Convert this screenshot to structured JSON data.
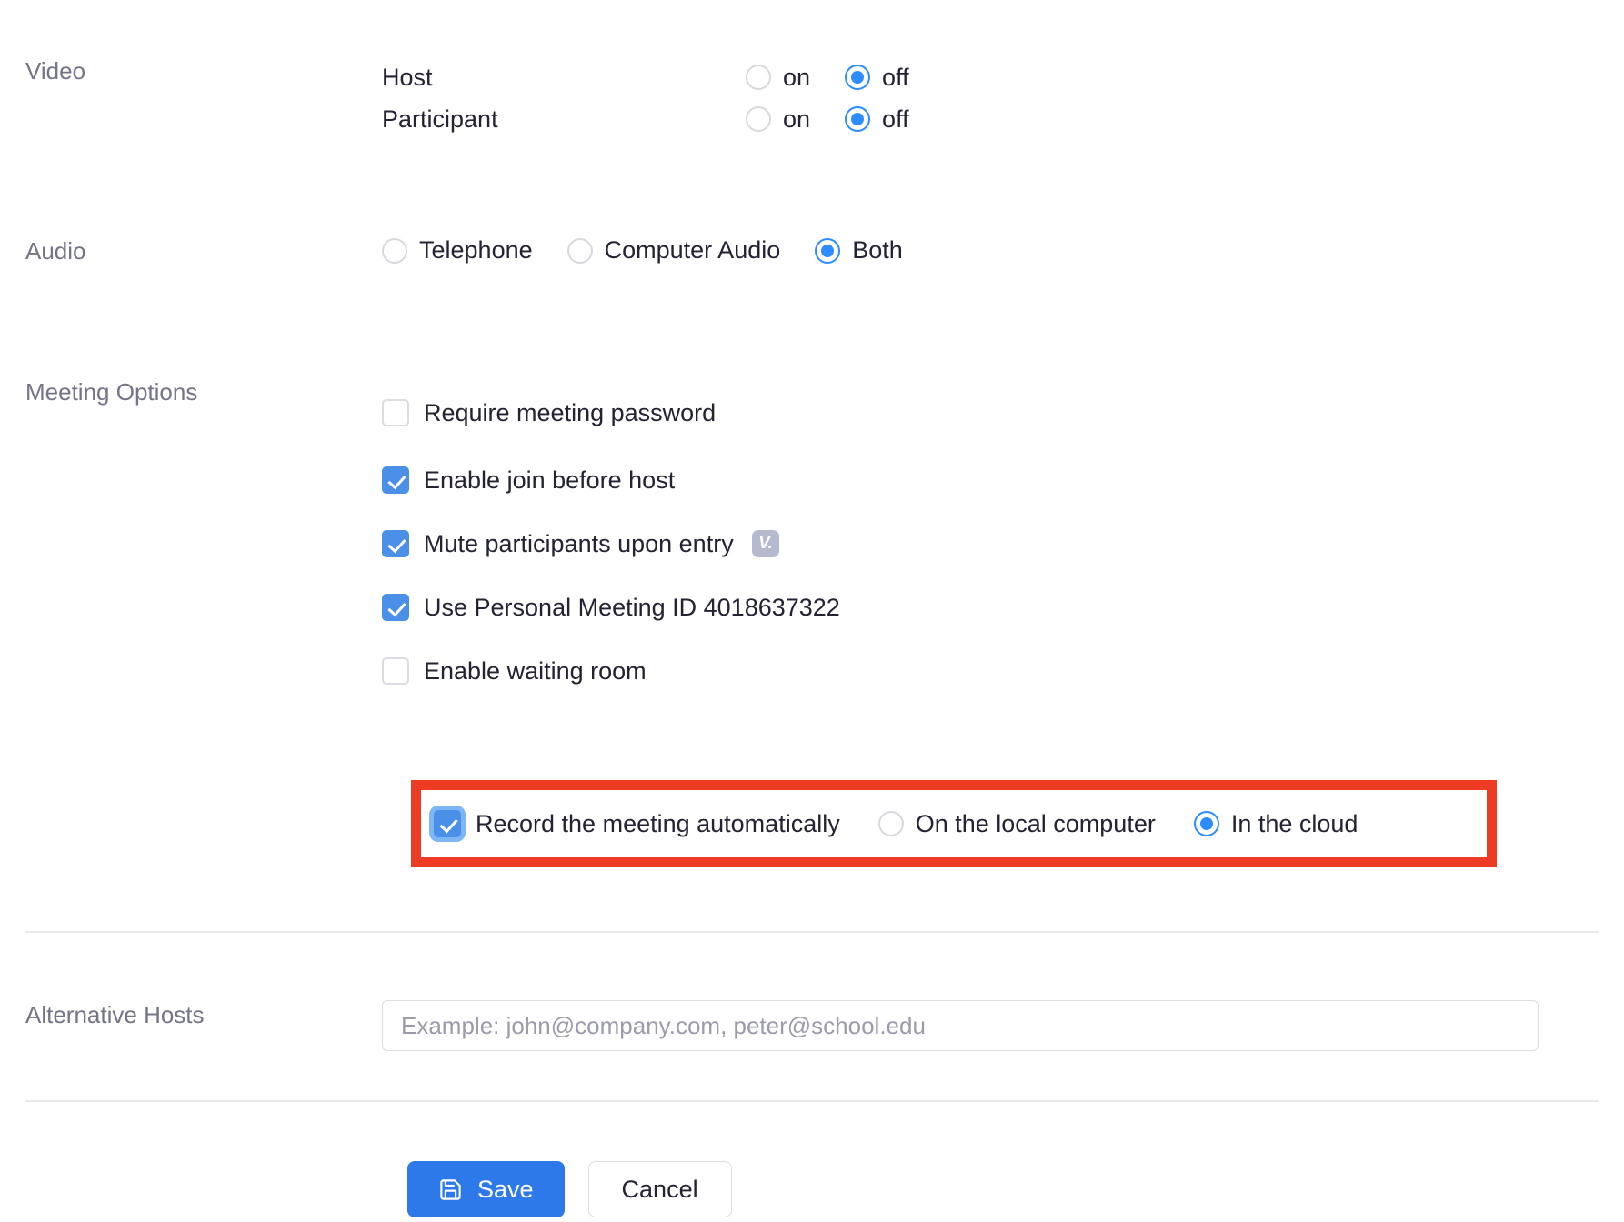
{
  "video": {
    "label": "Video",
    "rows": [
      {
        "name": "Host",
        "options": [
          {
            "label": "on",
            "selected": false
          },
          {
            "label": "off",
            "selected": true
          }
        ]
      },
      {
        "name": "Participant",
        "options": [
          {
            "label": "on",
            "selected": false
          },
          {
            "label": "off",
            "selected": true
          }
        ]
      }
    ]
  },
  "audio": {
    "label": "Audio",
    "options": [
      {
        "label": "Telephone",
        "selected": false
      },
      {
        "label": "Computer Audio",
        "selected": false
      },
      {
        "label": "Both",
        "selected": true
      }
    ]
  },
  "meeting_options": {
    "label": "Meeting Options",
    "items": [
      {
        "label": "Require meeting password",
        "checked": false,
        "badge": null
      },
      {
        "label": "Enable join before host",
        "checked": true,
        "badge": null
      },
      {
        "label": "Mute participants upon entry",
        "checked": true,
        "badge": "V."
      },
      {
        "label": "Use Personal Meeting ID 4018637322",
        "checked": true,
        "badge": null
      },
      {
        "label": "Enable waiting room",
        "checked": false,
        "badge": null
      }
    ],
    "record": {
      "label": "Record the meeting automatically",
      "checked": true,
      "focused": true,
      "destinations": [
        {
          "label": "On the local computer",
          "selected": false
        },
        {
          "label": "In the cloud",
          "selected": true
        }
      ]
    }
  },
  "alternative_hosts": {
    "label": "Alternative Hosts",
    "placeholder": "Example: john@company.com, peter@school.edu",
    "value": ""
  },
  "actions": {
    "save_label": "Save",
    "cancel_label": "Cancel",
    "save_icon": "floppy-disk-icon"
  },
  "colors": {
    "accent_blue": "#2D8CFF",
    "button_blue": "#2D79EA",
    "checkbox_blue": "#4A90E8",
    "highlight_red": "#EE3B23",
    "label_gray": "#747487",
    "text_dark": "#232333"
  }
}
